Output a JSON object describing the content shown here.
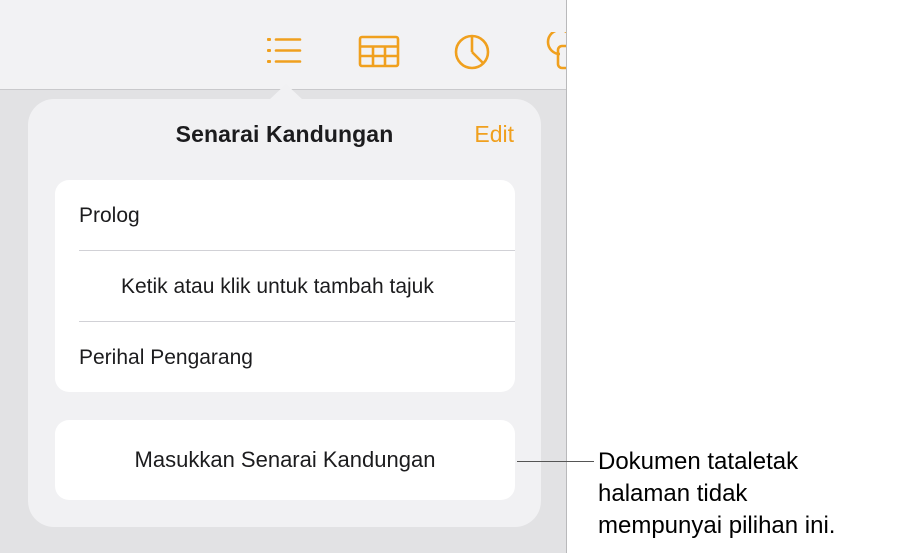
{
  "toolbar": {
    "icons": [
      "list-icon",
      "table-icon",
      "chart-icon",
      "shape-icon"
    ],
    "accent_color": "#f0a01e"
  },
  "popover": {
    "title": "Senarai Kandungan",
    "edit_label": "Edit",
    "toc_items": [
      "Prolog",
      "Ketik atau klik untuk tambah tajuk",
      "Perihal Pengarang"
    ],
    "insert_button_label": "Masukkan Senarai Kandungan"
  },
  "callout": {
    "lines": [
      "Dokumen tataletak",
      "halaman tidak",
      "mempunyai pilihan ini."
    ]
  }
}
